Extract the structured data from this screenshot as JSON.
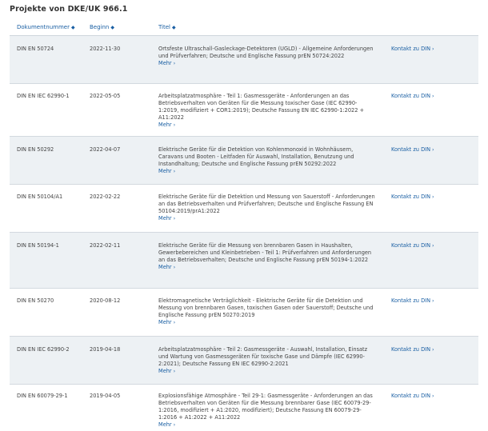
{
  "page": {
    "title": "Projekte von DKE/UK 966.1"
  },
  "table": {
    "columns": [
      {
        "label": "Dokumentnummer",
        "sort_icon": "sort-arrows-icon"
      },
      {
        "label": "Beginn",
        "sort_icon": "sort-arrows-icon"
      },
      {
        "label": "Titel",
        "sort_icon": "sort-arrows-icon"
      }
    ],
    "more_label": "Mehr",
    "contact_label": "Kontakt zu DIN",
    "rows": [
      {
        "doc": "DIN EN 50724",
        "date": "2022-11-30",
        "title": "Ortsfeste Ultraschall-Gasleckage-Detektoren (UGLD) - Allgemeine Anforderungen und Prüfverfahren; Deutsche und Englische Fassung prEN 50724:2022"
      },
      {
        "doc": "DIN EN IEC 62990-1",
        "date": "2022-05-05",
        "title": "Arbeitsplatzatmosphäre - Teil 1: Gasmessgeräte - Anforderungen an das Betriebsverhalten von Geräten für die Messung toxischer Gase (IEC 62990-1:2019, modifiziert + COR1:2019); Deutsche Fassung EN IEC 62990-1:2022 + A11:2022"
      },
      {
        "doc": "DIN EN 50292",
        "date": "2022-04-07",
        "title": "Elektrische Geräte für die Detektion von Kohlenmonoxid in Wohnhäusern, Caravans und Booten - Leitfaden für Auswahl, Installation, Benutzung und Instandhaltung; Deutsche und Englische Fassung prEN 50292:2022"
      },
      {
        "doc": "DIN EN 50104/A1",
        "date": "2022-02-22",
        "title": "Elektrische Geräte für die Detektion und Messung von Sauerstoff - Anforderungen an das Betriebsverhalten und Prüfverfahren; Deutsche und Englische Fassung EN 50104:2019/prA1:2022"
      },
      {
        "doc": "DIN EN 50194-1",
        "date": "2022-02-11",
        "title": "Elektrische Geräte für die Messung von brennbaren Gasen in Haushalten, Gewerbebereichen und Kleinbetrieben - Teil 1: Prüfverfahren und Anforderungen an das Betriebsverhalten; Deutsche und Englische Fassung prEN 50194-1:2022"
      },
      {
        "doc": "DIN EN 50270",
        "date": "2020-08-12",
        "title": "Elektromagnetische Verträglichkeit - Elektrische Geräte für die Detektion und Messung von brennbaren Gasen, toxischen Gasen oder Sauerstoff; Deutsche und Englische Fassung prEN 50270:2019"
      },
      {
        "doc": "DIN EN IEC 62990-2",
        "date": "2019-04-18",
        "title": "Arbeitsplatzatmosphäre - Teil 2: Gasmessgeräte - Auswahl, Installation, Einsatz und Wartung von Gasmessgeräten für toxische Gase und Dämpfe (IEC 62990-2:2021); Deutsche Fassung EN IEC 62990-2:2021"
      },
      {
        "doc": "DIN EN 60079-29-1",
        "date": "2019-04-05",
        "title": "Explosionsfähige Atmosphäre - Teil 29-1: Gasmessgeräte - Anforderungen an das Betriebsverhalten von Geräten für die Messung brennbarer Gase (IEC 60079-29-1:2016, modifiziert + A1:2020, modifiziert); Deutsche Fassung EN 60079-29-1:2016 + A1:2022 + A11:2022"
      }
    ]
  },
  "colors": {
    "link": "#1a5fa3",
    "row_alt": "#edf1f4",
    "border": "#d3d9df"
  }
}
